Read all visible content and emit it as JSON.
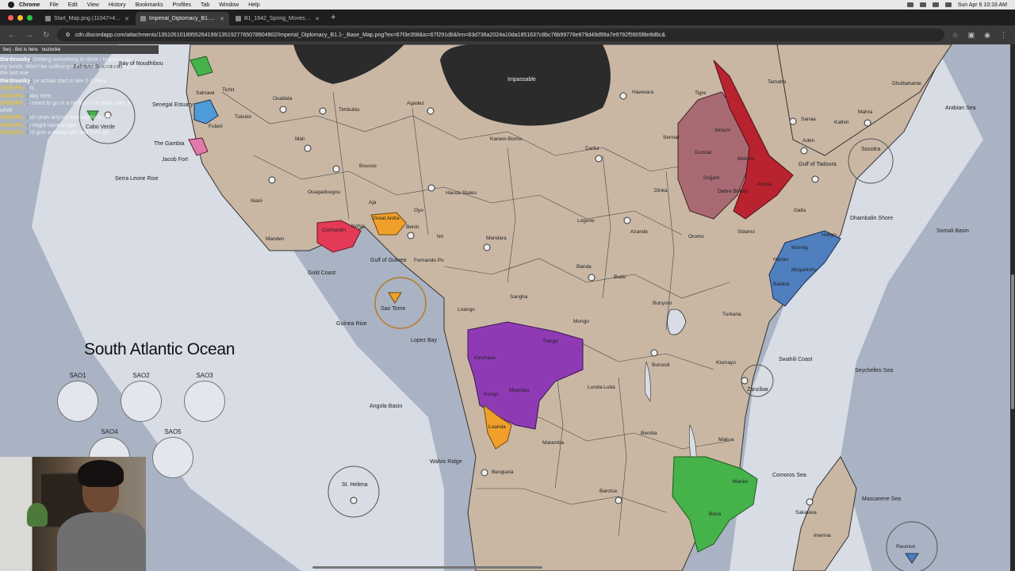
{
  "menubar": {
    "app": "Chrome",
    "items": [
      "File",
      "Edit",
      "View",
      "History",
      "Bookmarks",
      "Profiles",
      "Tab",
      "Window",
      "Help"
    ],
    "clock": "Sun Apr 6 10:16 AM"
  },
  "tabs": [
    {
      "label": "Start_Map.png (11047×4548)",
      "active": false
    },
    {
      "label": "Imperial_Diplomacy_B1.1-_Base",
      "active": true
    },
    {
      "label": "B1_1642_Spring_Moves.png",
      "active": false
    }
  ],
  "address": {
    "url": "cdn.discordapp.com/attachments/1351051018955264199/1351927765078904902/Imperial_Diplomacy_B1.1-_Base_Map.png?ex=67f3e358&is=67f291d8&hm=83d736a2024a10da1851637c8bc76b99778e879d49d99a7e9792f5905f8e8d6c&"
  },
  "chat": {
    "header": {
      "left": "Serj - Bot is here",
      "right": "nuzlocke"
    },
    "messages": [
      {
        "name": "thirdmunky",
        "color": "#e0e0e0",
        "text": "Getting something to drink / finishing up my lunch. Won't be suffering if this AAR goes as long as the last one"
      },
      {
        "name": "thirdmunky",
        "color": "#e0e0e0",
        "text": "ye actual start in like 2-3 mins"
      },
      {
        "name": "ShiftyFly_",
        "color": "#e7c43a",
        "text": "hi"
      },
      {
        "name": "ShiftyFly_",
        "color": "#e7c43a",
        "text": "aby here"
      },
      {
        "name": "ShiftyFly_",
        "color": "#e7c43a",
        "text": "i need to go in a bit but i'll be back after a while"
      },
      {
        "name": "ShiftyFly_",
        "color": "#e7c43a",
        "text": "oh yeah artymo was useful to me"
      },
      {
        "name": "ShiftyFly_",
        "color": "#e7c43a",
        "text": "i might have a wait"
      },
      {
        "name": "ShiftyFly_",
        "color": "#e7c43a",
        "text": "i'll give a paragraph and then go"
      }
    ]
  },
  "map": {
    "ocean_title": "South Atlantic Ocean",
    "sao_labels": [
      "SAO1",
      "SAO2",
      "SAO3",
      "SAO4",
      "SAO5"
    ],
    "sea_labels": [
      "Bay of Noudhibou",
      "Senegal Estuary",
      "The Gambia",
      "Jacob Fort",
      "Serra Leone Rise",
      "Gold Coast",
      "Gulf of Guinea",
      "Guinea Rise",
      "Sao Tome",
      "Lopez Bay",
      "Angola Basin",
      "Walvis Ridge",
      "St. Helena",
      "Arabian Sea",
      "Socotra",
      "Gulf of Tadoura",
      "Somali Basin",
      "Dhambalin Shore",
      "Swahili Coast",
      "Seychelles Sea",
      "Comoros Sea",
      "Mascarene Sea",
      "Zanzibar",
      "Cabo Verde",
      "Sahrawi Seamounts"
    ],
    "land_labels": [
      "Impassable",
      "Ouallata",
      "Timbuktu",
      "Agadez",
      "Kanem-Bornu",
      "Hawwara",
      "Tigre",
      "Tamaha",
      "Dhulbahante",
      "Sanaa",
      "Kathiri",
      "Mahra",
      "Aden",
      "Mali",
      "Sahrawi",
      "Tichit",
      "Tukulor",
      "Fulani",
      "Bousso",
      "Ouagadougou",
      "Niani",
      "Manden",
      "Cormantin",
      "Nofse",
      "Great Ardra",
      "Benin",
      "Oyo",
      "Aja",
      "Hausa States",
      "Nri",
      "Mandara",
      "Darfur",
      "Sennar",
      "Dinka",
      "Logone",
      "Azande",
      "Oromo",
      "Sidamo",
      "Gondar",
      "Aksum",
      "Mekele",
      "Gojjam",
      "Debre Birhan",
      "Aussa",
      "Galla",
      "Marreg",
      "Hobyo",
      "Harlan",
      "Mogadishu",
      "Baidoa",
      "Fernando Po",
      "Loango",
      "Sangha",
      "Mongo",
      "Banda",
      "Budu",
      "Bunyoro",
      "Turkana",
      "Burundi",
      "Kismayo",
      "Pango",
      "Kinshasa",
      "Kongo",
      "Mpemba",
      "Matamba",
      "Luanda",
      "Lunda-Luba",
      "Bemba",
      "Makua",
      "Maravi",
      "Beira",
      "Benguela",
      "Barotse",
      "Sakalava",
      "Imerina",
      "Reunion"
    ]
  },
  "colors": {
    "ocean": "#a9b3c3",
    "ocean_light": "#d7dce5",
    "land": "#c9b7a4",
    "impassable": "#2b2b2b",
    "purple": "#8f3ab5",
    "orange": "#f0a02a",
    "red": "#e23a57",
    "crimson": "#b8232f",
    "mauve": "#a86a73",
    "blue": "#4f7fbf",
    "green": "#45b24a"
  }
}
